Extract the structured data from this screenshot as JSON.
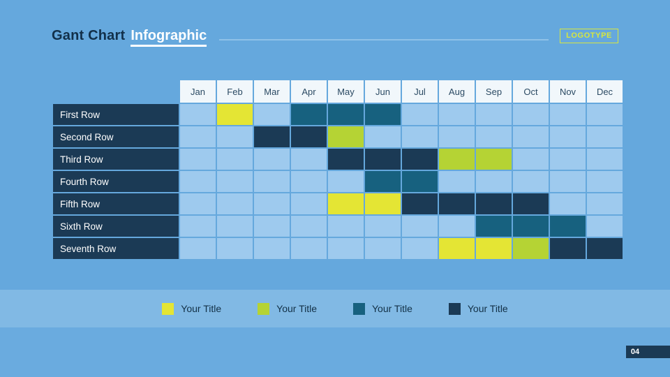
{
  "header": {
    "title_main": "Gant Chart",
    "title_accent": "Infographic",
    "logotype": "LOGOTYPE"
  },
  "legend": [
    {
      "label": "Your Title",
      "color": "#e4e534"
    },
    {
      "label": "Your Title",
      "color": "#b5d334"
    },
    {
      "label": "Your Title",
      "color": "#17617f"
    },
    {
      "label": "Your Title",
      "color": "#1b3a55"
    }
  ],
  "footer": {
    "page_number": "04"
  },
  "chart_data": {
    "type": "heatmap",
    "title": "Gant Chart Infographic",
    "xlabel": "",
    "ylabel": "",
    "categories": [
      "Jan",
      "Feb",
      "Mar",
      "Apr",
      "May",
      "Jun",
      "Jul",
      "Aug",
      "Sep",
      "Oct",
      "Nov",
      "Dec"
    ],
    "rows": [
      "First Row",
      "Second Row",
      "Third Row",
      "Fourth Row",
      "Fifth Row",
      "Sixth Row",
      "Seventh Row"
    ],
    "legend_position": "bottom",
    "grid": true,
    "color_key": {
      "0": "#9ecaee",
      "1": "#e4e534",
      "2": "#b5d334",
      "3": "#17617f",
      "4": "#1b3a55"
    },
    "values": [
      [
        0,
        1,
        0,
        3,
        3,
        3,
        0,
        0,
        0,
        0,
        0,
        0
      ],
      [
        0,
        0,
        4,
        4,
        2,
        0,
        0,
        0,
        0,
        0,
        0,
        0
      ],
      [
        0,
        0,
        0,
        0,
        4,
        4,
        4,
        2,
        2,
        0,
        0,
        0
      ],
      [
        0,
        0,
        0,
        0,
        0,
        3,
        3,
        0,
        0,
        0,
        0,
        0
      ],
      [
        0,
        0,
        0,
        0,
        1,
        1,
        4,
        4,
        4,
        4,
        0,
        0
      ],
      [
        0,
        0,
        0,
        0,
        0,
        0,
        0,
        0,
        3,
        3,
        3,
        0
      ],
      [
        0,
        0,
        0,
        0,
        0,
        0,
        0,
        1,
        1,
        2,
        4,
        4
      ]
    ]
  }
}
